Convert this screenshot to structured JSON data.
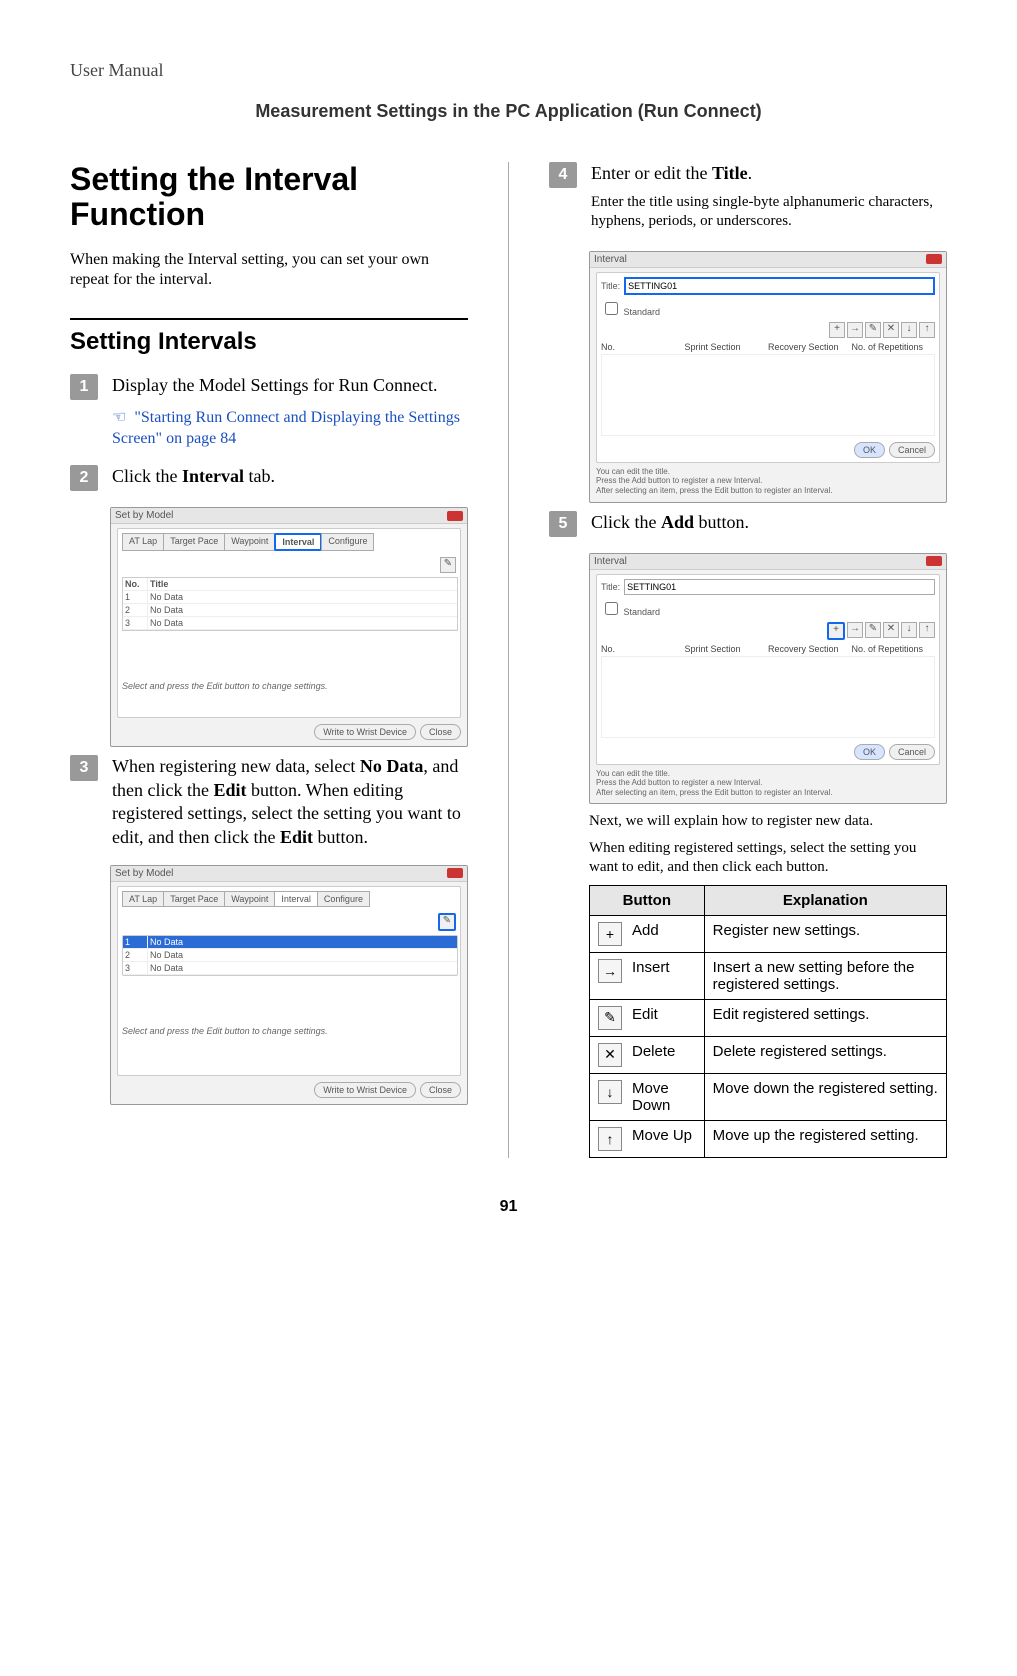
{
  "header": {
    "manual_link": "User Manual",
    "section_bar": "Measurement Settings in the PC Application (Run Connect)"
  },
  "left": {
    "title": "Setting the Interval Function",
    "intro": "When making the Interval setting, you can set your own repeat for the interval.",
    "sub_title": "Setting Intervals",
    "step1": {
      "no": "1",
      "text": "Display the Model Settings for Run Connect.",
      "xref": "\"Starting Run Connect and Displaying the Settings Screen\" on page 84"
    },
    "step2": {
      "no": "2",
      "text_pre": "Click the ",
      "text_b": "Interval",
      "text_post": " tab."
    },
    "step3": {
      "no": "3",
      "line": "When registering new data, select No Data, and then click the Edit button. When editing registered settings, select the setting you want to edit, and then click the Edit button.",
      "p1a": "When registering new data, select ",
      "p1b": "No Data",
      "p1c": ", and then click the ",
      "p1d": "Edit",
      "p1e": " button. When editing registered settings, select the setting you want to edit, and then click the ",
      "p1f": "Edit",
      "p1g": " button."
    }
  },
  "right": {
    "step4": {
      "no": "4",
      "text_pre": "Enter or edit the ",
      "text_b": "Title",
      "text_post": ".",
      "note": "Enter the title using single-byte alphanumeric characters, hyphens, periods, or underscores."
    },
    "step5": {
      "no": "5",
      "text_pre": "Click the ",
      "text_b": "Add",
      "text_post": " button.",
      "after1": "Next, we will explain how to register new data.",
      "after2": "When editing registered settings, select the setting you want to edit, and then click each button."
    },
    "table": {
      "head_button": "Button",
      "head_exp": "Explanation",
      "rows": [
        {
          "icon": "+",
          "name": "Add",
          "exp": "Register new settings."
        },
        {
          "icon": "→",
          "name": "Insert",
          "exp": "Insert a new setting before the registered settings."
        },
        {
          "icon": "✎",
          "name": "Edit",
          "exp": "Edit registered settings."
        },
        {
          "icon": "✕",
          "name": "Delete",
          "exp": "Delete registered settings."
        },
        {
          "icon": "↓",
          "name": "Move Down",
          "exp": "Move down the registered setting."
        },
        {
          "icon": "↑",
          "name": "Move Up",
          "exp": "Move up the registered setting."
        }
      ]
    }
  },
  "shots": {
    "set_by_model": "Set by Model",
    "interval_window": "Interval",
    "tabs": {
      "atlap": "AT Lap",
      "target": "Target Pace",
      "waypoint": "Waypoint",
      "interval": "Interval",
      "configure": "Configure"
    },
    "col_no": "No.",
    "col_title": "Title",
    "no_data": "No Data",
    "footer_msg": "Select and press the Edit button to change settings.",
    "write_btn": "Write to Wrist Device",
    "close_btn": "Close",
    "ok_btn": "OK",
    "cancel_btn": "Cancel",
    "title_label": "Title:",
    "title_value": "SETTING01",
    "standard": "Standard",
    "sprint": "Sprint Section",
    "recovery": "Recovery Section",
    "reps": "No. of Repetitions",
    "help1": "You can edit the title.",
    "help2": "Press the Add button to register a new Interval.",
    "help3": "After selecting an item, press the Edit button to register an Interval.",
    "edit_glyph": "✎",
    "add_glyph": "+",
    "insert_glyph": "→",
    "del_glyph": "✕",
    "down_glyph": "↓",
    "up_glyph": "↑"
  },
  "page_no": "91"
}
